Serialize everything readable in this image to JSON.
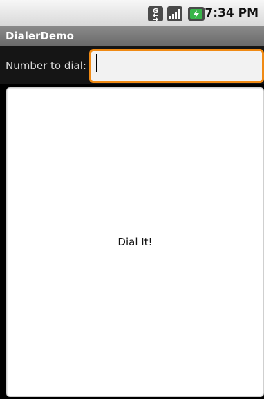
{
  "status_bar": {
    "time": "7:34 PM",
    "icons": [
      "network-data-icon",
      "signal-strength-icon",
      "battery-charging-icon"
    ]
  },
  "app": {
    "title": "DialerDemo"
  },
  "form": {
    "label": "Number to dial:",
    "input_value": ""
  },
  "actions": {
    "dial_button_label": "Dial It!"
  },
  "colors": {
    "focus_border": "#f08a14",
    "titlebar": "#7a7a7a",
    "input_background": "#f2f2f2",
    "battery_green": "#39b54a"
  }
}
